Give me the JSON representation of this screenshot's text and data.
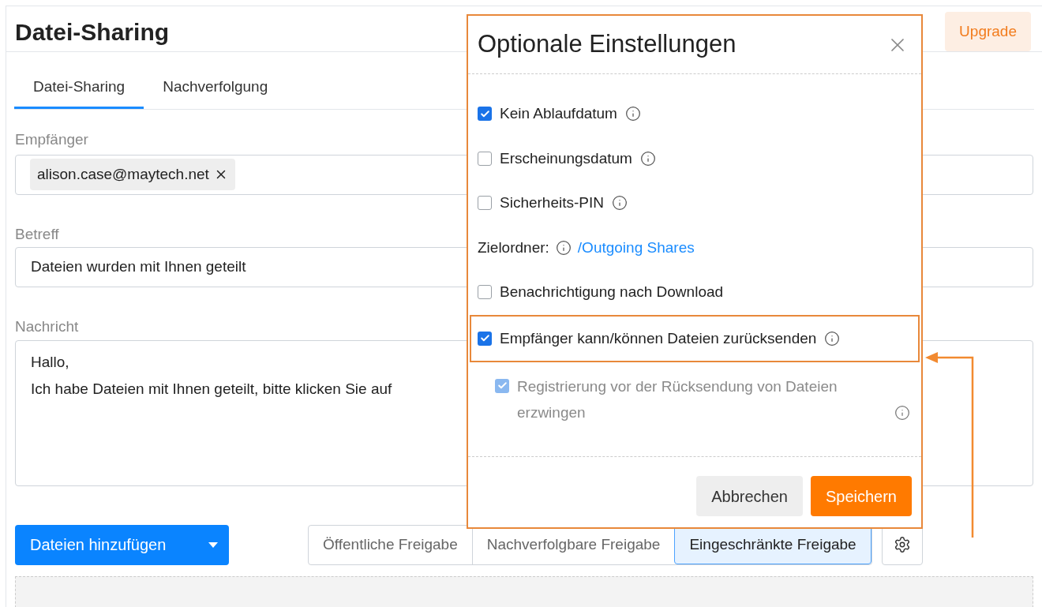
{
  "header": {
    "title": "Datei-Sharing",
    "upgrade_button": "Upgrade"
  },
  "tabs": [
    {
      "label": "Datei-Sharing",
      "selected": true
    },
    {
      "label": "Nachverfolgung",
      "selected": false
    }
  ],
  "recipients": {
    "label": "Empfänger",
    "chips": [
      {
        "text": "alison.case@maytech.net"
      }
    ]
  },
  "subject": {
    "label": "Betreff",
    "value": "Dateien wurden mit Ihnen geteilt"
  },
  "message": {
    "label": "Nachricht",
    "lines": [
      "Hallo,",
      "Ich habe Dateien mit Ihnen geteilt, bitte klicken Sie auf"
    ]
  },
  "add_files_button": "Dateien hinzufügen",
  "share_modes": [
    {
      "label": "Öffentliche Freigabe",
      "selected": false
    },
    {
      "label": "Nachverfolgbare Freigabe",
      "selected": false
    },
    {
      "label": "Eingeschränkte Freigabe",
      "selected": true
    }
  ],
  "dialog": {
    "title": "Optionale Einstellungen",
    "options": [
      {
        "kind": "checkbox",
        "label": "Kein Ablaufdatum",
        "checked": true,
        "info": true,
        "highlighted": false
      },
      {
        "kind": "checkbox",
        "label": "Erscheinungsdatum",
        "checked": false,
        "info": true,
        "highlighted": false
      },
      {
        "kind": "checkbox",
        "label": "Sicherheits-PIN",
        "checked": false,
        "info": true,
        "highlighted": false
      },
      {
        "kind": "folder",
        "label": "Zielordner:",
        "link": "/Outgoing Shares",
        "info": true,
        "highlighted": false
      },
      {
        "kind": "checkbox",
        "label": "Benachrichtigung nach Download",
        "checked": false,
        "info": false,
        "highlighted": false
      },
      {
        "kind": "checkbox",
        "label": "Empfänger kann/können Dateien zurücksenden",
        "checked": true,
        "info": true,
        "highlighted": true
      },
      {
        "kind": "sub_checkbox",
        "label": "Registrierung vor der Rücksendung von Dateien erzwingen",
        "checked": true,
        "disabled": true,
        "info": true,
        "highlighted": false
      }
    ],
    "buttons": [
      {
        "label": "Abbrechen",
        "kind": "secondary"
      },
      {
        "label": "Speichern",
        "kind": "primary"
      }
    ]
  }
}
